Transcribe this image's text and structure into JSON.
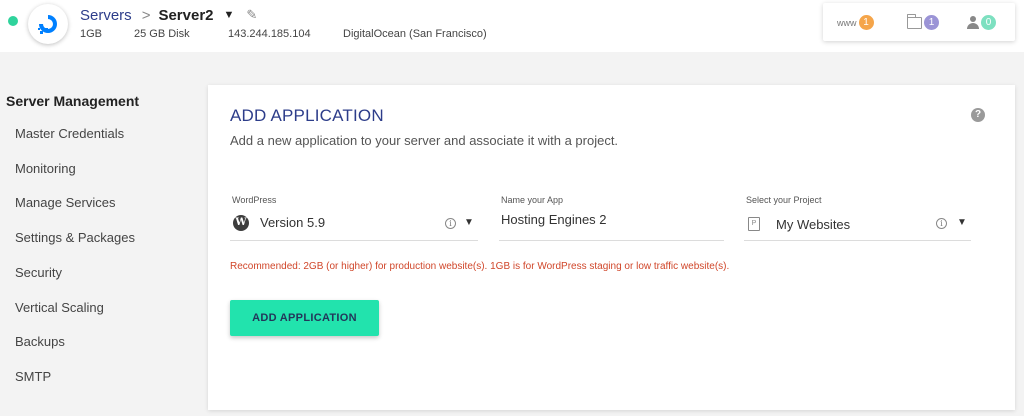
{
  "header": {
    "breadcrumb": {
      "parent": "Servers",
      "separator": ">",
      "current": "Server2"
    },
    "dropdown_icon": "caret-down-icon",
    "edit_icon": "pencil-icon",
    "server_meta": {
      "ram": "1GB",
      "disk": "25 GB Disk",
      "ip": "143.244.185.104",
      "provider": "DigitalOcean (San Francisco)"
    },
    "status_color": "#2fd39c",
    "counters": [
      {
        "icon": "www-icon",
        "label": "www",
        "count": "1",
        "color": "#f5a54a"
      },
      {
        "icon": "folder-icon",
        "count": "1",
        "color": "#9b94d6"
      },
      {
        "icon": "user-icon",
        "count": "0",
        "color": "#7de0c0"
      }
    ]
  },
  "sidebar": {
    "title": "Server Management",
    "items": [
      "Master Credentials",
      "Monitoring",
      "Manage Services",
      "Settings & Packages",
      "Security",
      "Vertical Scaling",
      "Backups",
      "SMTP"
    ]
  },
  "main": {
    "title": "ADD APPLICATION",
    "subtitle": "Add a new application to your server and associate it with a project.",
    "help_icon": "help-circle-icon",
    "help_glyph": "?",
    "fields": {
      "application": {
        "label": "WordPress",
        "value": "Version 5.9",
        "icon": "wordpress-icon"
      },
      "app_name": {
        "label": "Name your App",
        "value": "Hosting Engines 2"
      },
      "project": {
        "label": "Select your Project",
        "value": "My Websites",
        "icon": "project-icon"
      }
    },
    "warning": "Recommended: 2GB (or higher) for production website(s). 1GB is for WordPress staging or low traffic website(s).",
    "submit_label": "ADD APPLICATION"
  },
  "colors": {
    "accent": "#22e3ad",
    "title": "#2d3d8a",
    "warning": "#d0462a"
  }
}
